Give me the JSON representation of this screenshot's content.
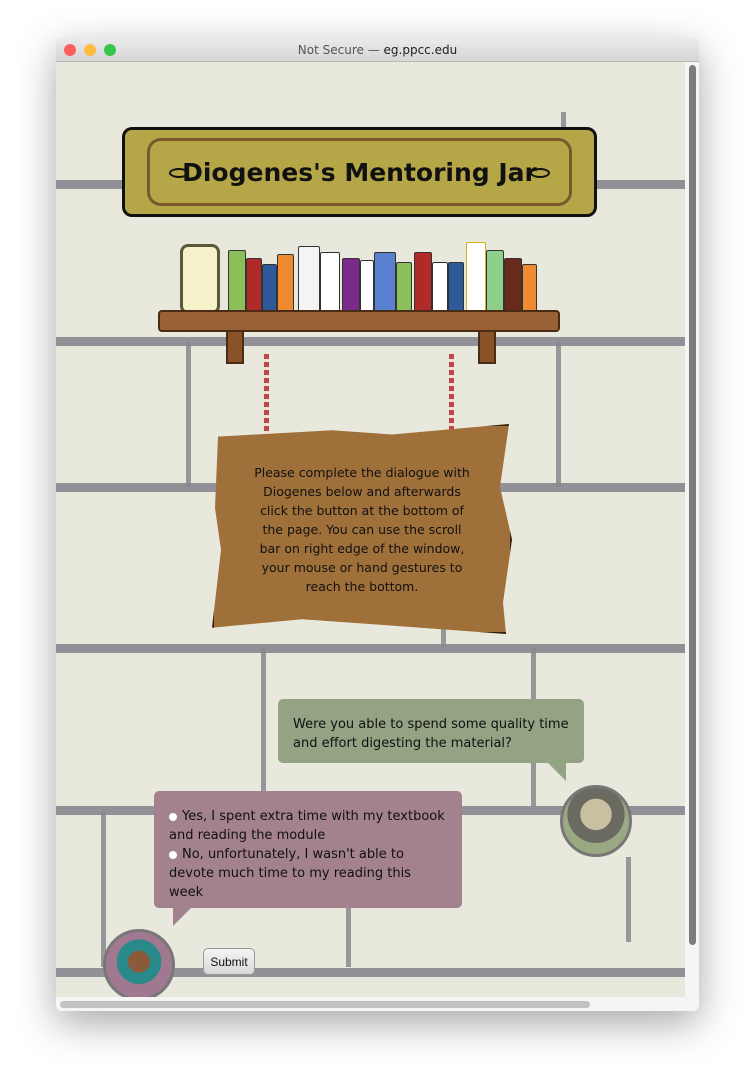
{
  "window": {
    "title_prefix": "Not Secure — ",
    "domain": "eg.ppcc.edu"
  },
  "page": {
    "title": "Diogenes's Mentoring Jar",
    "instructions": "Please complete the dialogue with Diogenes below and afterwards click the button at the bottom of the page. You can use the scroll bar on right edge of the window, your mouse or hand gestures to reach the bottom.",
    "question": "Were you able to spend some quality time and effort digesting the material?",
    "options": [
      "Yes, I spent extra time with my textbook and reading the module",
      "No, unfortunately, I wasn't able to devote much time to my reading this week"
    ],
    "submit_label": "Submit"
  },
  "colors": {
    "wall": "#e9e8dc",
    "title_board": "#b5a747",
    "wood_sign": "#a0703a",
    "mentor_bubble": "#94a384",
    "student_bubble": "#a3818f"
  }
}
